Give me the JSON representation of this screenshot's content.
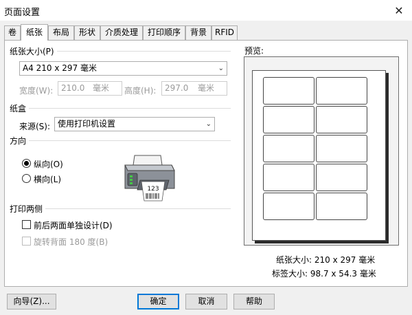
{
  "window": {
    "title": "页面设置",
    "close_glyph": "✕"
  },
  "tabs": [
    {
      "label": "卷",
      "active": false
    },
    {
      "label": "纸张",
      "active": true
    },
    {
      "label": "布局",
      "active": false
    },
    {
      "label": "形状",
      "active": false
    },
    {
      "label": "介质处理",
      "active": false
    },
    {
      "label": "打印顺序",
      "active": false
    },
    {
      "label": "背景",
      "active": false
    },
    {
      "label": "RFID",
      "active": false
    }
  ],
  "paper_size": {
    "group_label": "纸张大小(P)",
    "selected": "A4 210 x 297 毫米",
    "width_label": "宽度(W):",
    "width_value": "210.0",
    "width_unit": "毫米",
    "height_label": "高度(H):",
    "height_value": "297.0",
    "height_unit": "毫米"
  },
  "tray": {
    "group_label": "纸盒",
    "source_label": "来源(S):",
    "source_value": "使用打印机设置"
  },
  "orientation": {
    "group_label": "方向",
    "portrait_label": "纵向(O)",
    "landscape_label": "横向(L)",
    "selected": "portrait",
    "printer_label_text": "123"
  },
  "duplex": {
    "group_label": "打印两侧",
    "separate_design_label": "前后两面单独设计(D)",
    "rotate_back_label": "旋转背面 180 度(B)"
  },
  "preview": {
    "label": "预览:",
    "paper_size_text": "纸张大小:  210 x 297 毫米",
    "label_size_text": "标签大小:  98.7 x 54.3 毫米",
    "rows": 5,
    "cols": 2
  },
  "buttons": {
    "wizard": "向导(Z)...",
    "ok": "确定",
    "cancel": "取消",
    "help": "帮助"
  },
  "colors": {
    "accent": "#0078d7",
    "border": "#adadad"
  }
}
